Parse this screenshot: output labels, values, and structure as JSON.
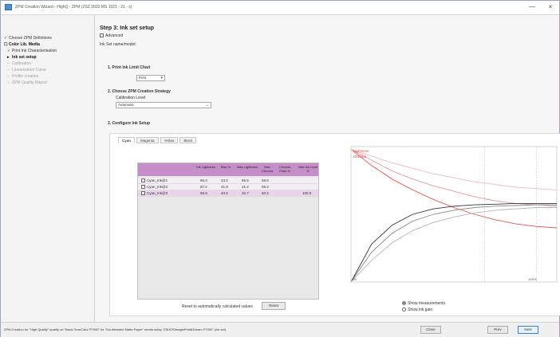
{
  "window": {
    "title": "ZPM Creation Wizard - HighQ - ZPM (ZSZ 2020 MS 1021 - 21 - s)",
    "min_glyph": "—",
    "close_glyph": "×"
  },
  "sidebar": {
    "items": [
      {
        "mark": "✓",
        "label": "Choose ZPM Definitions",
        "state": "done"
      },
      {
        "mark": "☐",
        "label": "Color Lib. Media",
        "state": "active"
      },
      {
        "mark": "✓",
        "label": "Print Ink Characterisation",
        "state": "done"
      },
      {
        "mark": "▸",
        "label": "Ink set setup",
        "state": "current"
      },
      {
        "mark": "–",
        "label": "Calibration",
        "state": "pending"
      },
      {
        "mark": "–",
        "label": "Linearization Curve",
        "state": "pending"
      },
      {
        "mark": "–",
        "label": "Profile creation",
        "state": "pending"
      },
      {
        "mark": "–",
        "label": "ZPM Quality Report",
        "state": "pending"
      }
    ]
  },
  "main": {
    "step_title": "Step 3: Ink set setup",
    "advanced_label": "Advanced",
    "intro": "Ink Set name/model:",
    "section1": {
      "title": "1. Print Ink Limit Chart",
      "button": "Print"
    },
    "section2": {
      "title": "2. Choose ZPM Creation Strategy",
      "sublabel": "Calibration Level",
      "value": "Automatic"
    },
    "section3": {
      "title": "3. Configure Ink Setup"
    },
    "tabs": [
      "Cyan",
      "Magenta",
      "Yellow",
      "Black"
    ],
    "table": {
      "columns": [
        "",
        "Ink Lightness",
        "Max %",
        "Max Lightness",
        "Max Chroma",
        "Chroma Peak %",
        "Max Ink Limit %"
      ],
      "rows": [
        {
          "name": "Cyan_Ink@1",
          "c1": "96.3",
          "c2": "43.2",
          "c3": "85.6",
          "c4": "58.6",
          "c5": "",
          "c6": ""
        },
        {
          "name": "Cyan_Ink@2",
          "c1": "87.2",
          "c2": "41.9",
          "c3": "41.4",
          "c4": "55.2",
          "c5": "",
          "c6": ""
        },
        {
          "name": "Cyan_Ink@3",
          "c1": "98.9",
          "c2": "40.5",
          "c3": "40.7",
          "c4": "60.2",
          "c5": "",
          "c6": "100.0"
        }
      ]
    },
    "chart_panel": {
      "legend": [
        "Lightness",
        "Chroma"
      ],
      "x_start": "0%",
      "x_end": "100%",
      "chart_data": {
        "type": "line",
        "x": [
          0,
          10,
          20,
          30,
          40,
          50,
          60,
          70,
          80,
          90,
          100
        ],
        "series": [
          {
            "name": "Lightness",
            "color": "#e2564a",
            "values": [
              98,
              86,
              76,
              68,
              61,
              55,
              50,
              46,
              43,
              41,
              40
            ]
          },
          {
            "color": "#e89a9a",
            "values": [
              98,
              90,
              82,
              76,
              71,
              67,
              63,
              60,
              58,
              57,
              56
            ]
          },
          {
            "color": "#eebcbc",
            "values": [
              98,
              93,
              88,
              84,
              80,
              77,
              74,
              72,
              70,
              69,
              68
            ]
          },
          {
            "name": "Chroma",
            "color": "#333333",
            "values": [
              0,
              28,
              42,
              50,
              54,
              56,
              57,
              57.5,
              58,
              58,
              58
            ]
          },
          {
            "color": "#888888",
            "values": [
              0,
              22,
              36,
              45,
              50,
              53,
              55,
              56,
              56.5,
              57,
              57
            ]
          },
          {
            "color": "#b3b3b3",
            "values": [
              0,
              16,
              29,
              38,
              44,
              48,
              51,
              53,
              54,
              55,
              55
            ]
          }
        ],
        "ylim": [
          0,
          100
        ],
        "xlim": [
          0,
          100
        ],
        "vlines": [
          65,
          90
        ]
      }
    },
    "radios": [
      {
        "label": "Show measurements",
        "checked": true
      },
      {
        "label": "Show ink gain",
        "checked": false
      }
    ],
    "auto_calc": {
      "label": "Reset to automatically calculated values",
      "button": "Reset"
    }
  },
  "status": {
    "text": "ZPM Creation for \"High Quality\" quality on \"Basic SureColor P7000\" for \"Doublesided Matte Paper\" media using \"ZSHOSImaginPrint&Dream P7000\" (ink set)",
    "buttons": {
      "close": "Close",
      "prev": "Prev",
      "next": "Next"
    }
  }
}
